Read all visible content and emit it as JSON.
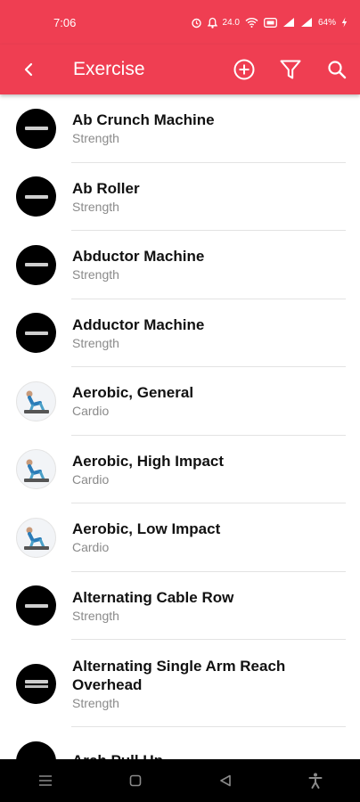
{
  "status_bar": {
    "time": "7:06",
    "data_speed": "24.0",
    "battery": "64%"
  },
  "app_bar": {
    "title": "Exercise",
    "actions": [
      "add-icon",
      "filter-icon",
      "search-icon"
    ]
  },
  "exercises": [
    {
      "name": "Ab Crunch Machine",
      "category": "Strength",
      "thumb": "dark"
    },
    {
      "name": "Ab Roller",
      "category": "Strength",
      "thumb": "dark"
    },
    {
      "name": "Abductor Machine",
      "category": "Strength",
      "thumb": "dark"
    },
    {
      "name": "Adductor Machine",
      "category": "Strength",
      "thumb": "dark"
    },
    {
      "name": "Aerobic, General",
      "category": "Cardio",
      "thumb": "photo"
    },
    {
      "name": "Aerobic, High Impact",
      "category": "Cardio",
      "thumb": "photo"
    },
    {
      "name": "Aerobic, Low Impact",
      "category": "Cardio",
      "thumb": "photo"
    },
    {
      "name": "Alternating Cable Row",
      "category": "Strength",
      "thumb": "dark"
    },
    {
      "name": "Alternating Single Arm Reach Overhead",
      "category": "Strength",
      "thumb": "dark"
    },
    {
      "name": "Arch Pull Up",
      "category": "",
      "thumb": "dark"
    }
  ],
  "colors": {
    "accent": "#ef3e52",
    "nav_bar": "#000000"
  }
}
